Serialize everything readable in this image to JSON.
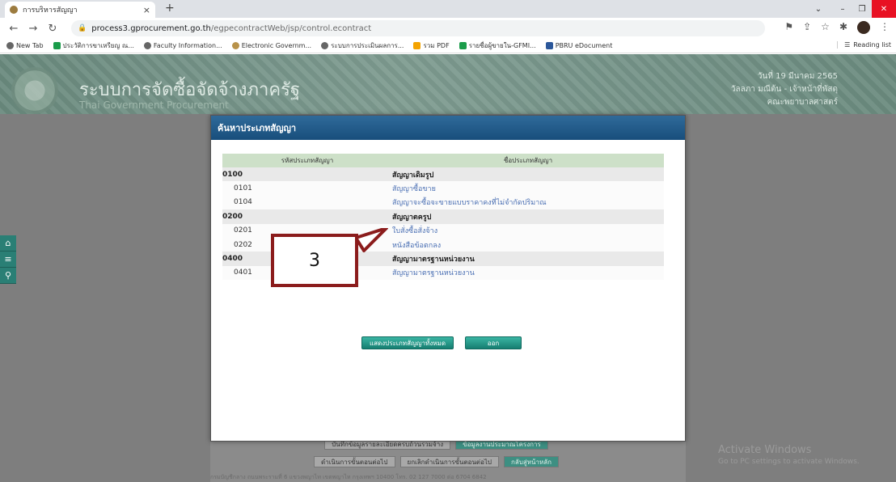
{
  "browser": {
    "tab_title": "การบริหารสัญญา",
    "tab_close": "×",
    "new_tab": "+",
    "url_host": "process3.gprocurement.go.th",
    "url_path": "/egpecontractWeb/jsp/control.econtract",
    "bookmarks": [
      "New Tab",
      "ประวัติการขาเหรียญ ณ...",
      "Faculty Information...",
      "Electronic Governm...",
      "ระบบการประเมินผลการ...",
      "รวม PDF",
      "รายชื่อผู้ขายใน-GFMI...",
      "PBRU eDocument"
    ],
    "reading_list": "Reading list"
  },
  "header": {
    "title": "ระบบการจัดซื้อจัดจ้างภาครัฐ",
    "subtitle": "Thai Government Procurement",
    "user_date": "วันที่ 19 มีนาคม 2565",
    "user_name": "วัลลภา มณีต้น - เจ้าหน้าที่พัสดุ",
    "user_org": "คณะพยาบาลศาสตร์"
  },
  "modal": {
    "title": "ค้นหาประเภทสัญญา",
    "col_code": "รหัสประเภทสัญญา",
    "col_name": "ชื่อประเภทสัญญา",
    "rows": [
      {
        "code": "0100",
        "name": "สัญญาเดิมรูป",
        "group": true
      },
      {
        "code": "0101",
        "name": "สัญญาซื้อขาย",
        "group": false
      },
      {
        "code": "0104",
        "name": "สัญญาจะซื้อจะขายแบบราคาคงที่ไม่จำกัดปริมาณ",
        "group": false
      },
      {
        "code": "0200",
        "name": "สัญญาตครูป",
        "group": true
      },
      {
        "code": "0201",
        "name": "ใบสั่งซื้อสั่งจ้าง",
        "group": false
      },
      {
        "code": "0202",
        "name": "หนังสือข้อตกลง",
        "group": false
      },
      {
        "code": "0400",
        "name": "สัญญามาตรฐานหน่วยงาน",
        "group": true
      },
      {
        "code": "0401",
        "name": "สัญญามาตรฐานหน่วยงาน",
        "group": false
      }
    ],
    "show_all_button": "แสดงประเภทสัญญาทั้งหมด",
    "exit_button": "ออก"
  },
  "background_buttons": {
    "save_detail": "บันทึกข้อมูลรายละเอียดครบถ้วนรวมจ้าง",
    "project_info": "ข้อมูลงานประมาณโครงการ",
    "next_step": "ดำเนินการขั้นตอนต่อไป",
    "cancel_step": "ยกเลิกดำเนินการขั้นตอนต่อไป",
    "back_home": "กลับสู่หน้าหลัก"
  },
  "footer": "กรมบัญชีกลาง ถนนพระรามที่ 6 แขวงพญาไท เขตพญาไท กรุงเทพฯ 10400 โทร. 02 127 7000 ต่อ 6704 6842",
  "watermark": {
    "line1": "Activate Windows",
    "line2": "Go to PC settings to activate Windows."
  },
  "annotation": {
    "label": "3"
  },
  "colors": {
    "modal_header": "#184e7c",
    "table_header": "#cde0c8",
    "link": "#4a6fb3",
    "callout_border": "#8b1c1c",
    "button_teal": "#167e71"
  }
}
